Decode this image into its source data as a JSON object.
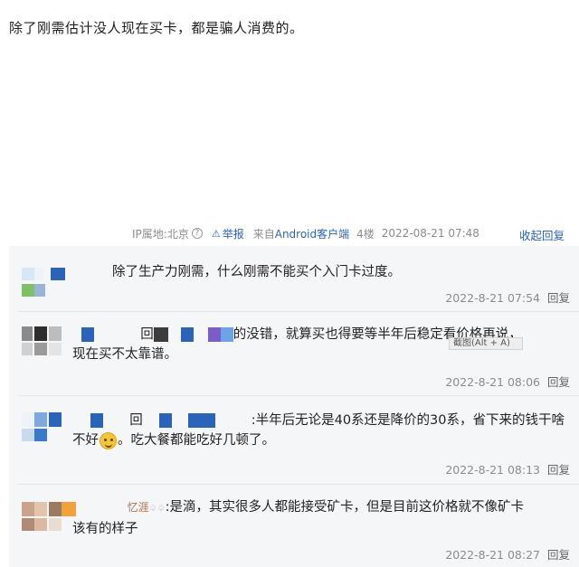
{
  "post": {
    "text": "除了刚需估计没人现在买卡，都是骗人消费的。",
    "ip": "IP属地:北京",
    "help_icon": "question-icon",
    "report_label": "举报",
    "source_prefix": "来自",
    "source_link": "Android客户端",
    "floor": "4楼",
    "time": "2022-08-21 07:48",
    "collapse_label": "收起回复"
  },
  "replies": [
    {
      "name_prefix": "",
      "text_line1": "除了生产力刚需，什么刚需不能买个入门卡过度。",
      "text_line2": "",
      "time": "2022-8-21 07:54",
      "reply_label": "回复"
    },
    {
      "name_prefix": "回",
      "text_line1": "的没错，就算买也得要等半年后稳定看价格再说，",
      "text_line2": "现在买不太靠谱。",
      "time": "2022-8-21 08:06",
      "reply_label": "回复"
    },
    {
      "name_prefix": "回",
      "text_line1": ":半年后无论是40系还是降价的30系，省下来的钱干啥",
      "text_line2_a": "不好",
      "text_line2_b": "。吃大餐都能吃好几顿了。",
      "time": "2022-8-21 08:13",
      "reply_label": "回复"
    },
    {
      "name_prefix": "忆涯",
      "text_line1": ":是滴，其实很多人都能接受矿卡，但是目前这价格就不像矿卡",
      "text_line2": "该有的样子",
      "time": "2022-8-21 08:27",
      "reply_label": "回复"
    }
  ],
  "tooltip_fragment": "截图(Alt + A)",
  "colors": {
    "link_blue": "#2d64b3",
    "meta_grey": "#8c8c8c",
    "panel_bg": "#f5f6f8"
  }
}
